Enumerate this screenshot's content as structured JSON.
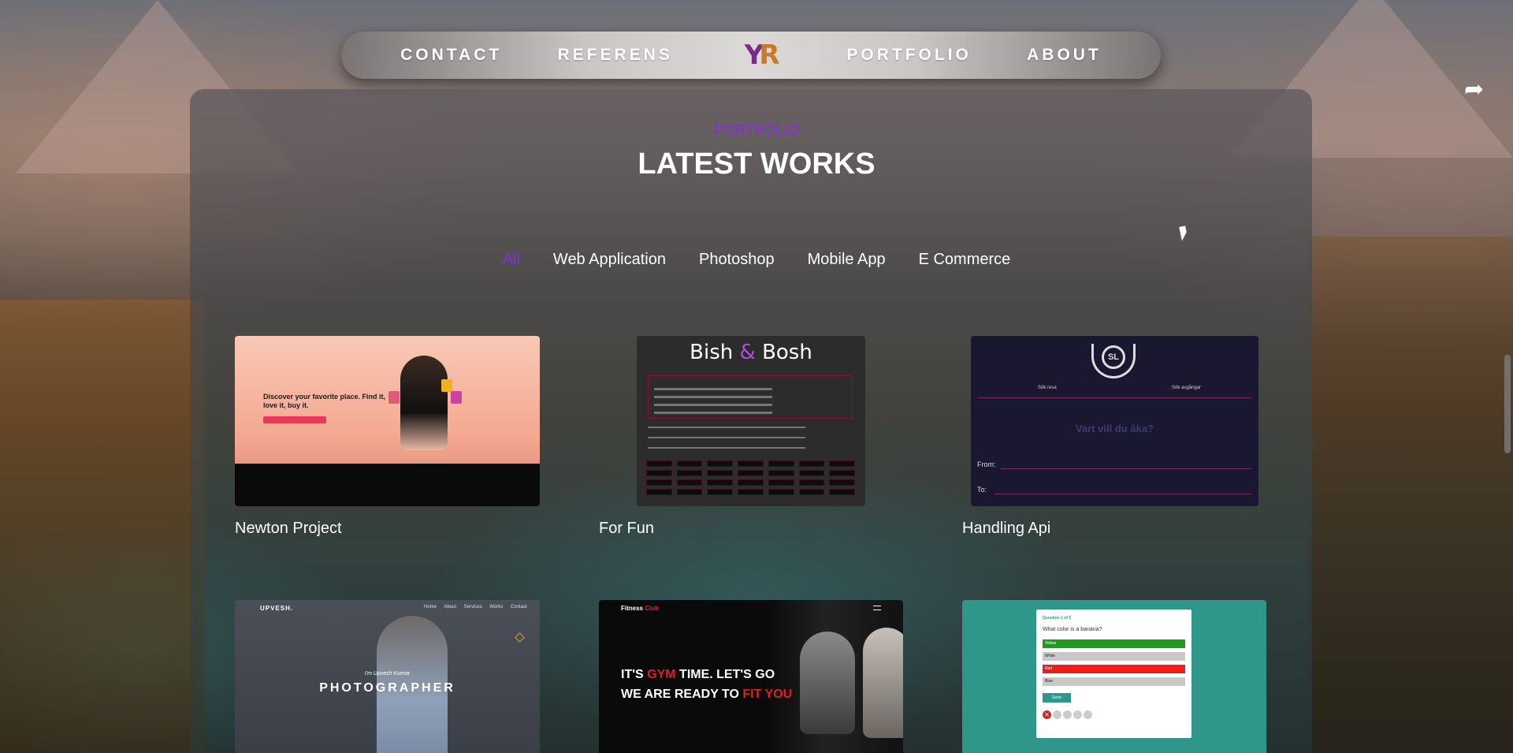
{
  "nav": {
    "items": [
      {
        "label": "CONTACT"
      },
      {
        "label": "REFERENS"
      },
      {
        "label": "PORTFOLIO"
      },
      {
        "label": "ABOUT"
      }
    ],
    "logo_text": "YR"
  },
  "section": {
    "subtitle": "PORTFOLIO",
    "title": "LATEST WORKS"
  },
  "filters": [
    {
      "label": "All",
      "active": true
    },
    {
      "label": "Web Application",
      "active": false
    },
    {
      "label": "Photoshop",
      "active": false
    },
    {
      "label": "Mobile App",
      "active": false
    },
    {
      "label": "E Commerce",
      "active": false
    }
  ],
  "projects": [
    {
      "title": "Newton Project",
      "thumb": {
        "headline": "Discover your favorite place. Find it, love it, buy it."
      }
    },
    {
      "title": "For Fun",
      "thumb": {
        "heading": "Bish",
        "amp": "&",
        "heading2": "Bosh"
      }
    },
    {
      "title": "Handling Api",
      "thumb": {
        "logo": "SL",
        "tab1": "Sök resa",
        "tab2": "Sök avgångar",
        "question": "Vart vill du åka?",
        "from": "From:",
        "to": "To:"
      }
    },
    {
      "title": "",
      "thumb": {
        "brand": "UPVESH.",
        "menu": "Home About Services Works Contact",
        "intro": "I'm Upvesh Kumar",
        "role": "PHOTOGRAPHER"
      }
    },
    {
      "title": "",
      "thumb": {
        "brand": "Fitness",
        "brand2": "Club",
        "line1a": "IT'S ",
        "line1b": "GYM",
        "line1c": " TIME. LET'S GO",
        "line2a": "WE ARE READY TO ",
        "line2b": "FIT YOU"
      }
    },
    {
      "title": "",
      "thumb": {
        "header": "Question 1 of 5",
        "question": "What color is a banana?",
        "options": [
          "Yellow",
          "White",
          "Red",
          "Blue"
        ],
        "send": "Send"
      }
    }
  ],
  "colors": {
    "accent": "#8a2be2",
    "text": "#ffffff",
    "nav_bg": "#d6d2d2"
  },
  "icons": {
    "share": "share-icon",
    "cursor": "mouse-cursor"
  }
}
